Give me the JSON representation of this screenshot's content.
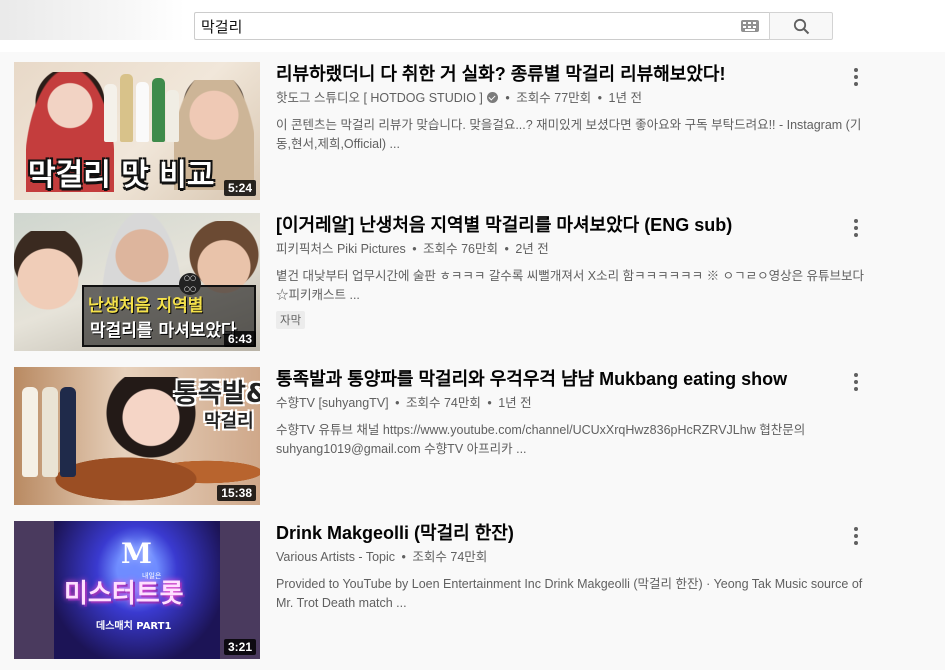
{
  "search": {
    "query": "막걸리",
    "keyboard_icon": "keyboard-icon",
    "button_icon": "search-icon"
  },
  "videos": [
    {
      "title": "리뷰하랬더니 다 취한 거 실화? 종류별 막걸리 리뷰해보았다!",
      "channel": "핫도그 스튜디오 [ HOTDOG STUDIO ]",
      "verified": true,
      "views": "조회수 77만회",
      "age": "1년 전",
      "description": "이 콘텐츠는 막걸리 리뷰가 맞습니다. 맞을걸요...? 재미있게 보셨다면 좋아요와 구독 부탁드려요!! - Instagram (기동,현서,제희,Official) ...",
      "duration": "5:24",
      "thumb_text": [
        "막걸리 맛 비교"
      ],
      "badge": ""
    },
    {
      "title": "[이거레알] 난생처음 지역별 막걸리를 마셔보았다 (ENG sub)",
      "channel": "피키픽처스 Piki Pictures",
      "verified": false,
      "views": "조회수 76만회",
      "age": "2년 전",
      "description": "볕건 대낮부터 업무시간에 술판 ㅎㅋㅋㅋ 갈수록 씨뻘개져서 X소리 함ㅋㅋㅋㅋㅋㅋ ※ ㅇㄱㄹㅇ영상은 유튜브보다 ☆피키캐스트 ...",
      "duration": "6:43",
      "thumb_text": [
        "난생처음 지역별",
        "막걸리를 마셔보았다"
      ],
      "badge": "자막"
    },
    {
      "title": "통족발과 통양파를 막걸리와 우걱우걱 냠냠 Mukbang eating show",
      "channel": "수향TV [suhyangTV]",
      "verified": false,
      "views": "조회수 74만회",
      "age": "1년 전",
      "description": "수향TV 유튜브 채널 https://www.youtube.com/channel/UCUxXrqHwz836pHcRZRVJLhw 협찬문의 suhyang1019@gmail.com 수향TV 아프리카 ...",
      "duration": "15:38",
      "thumb_text": [
        "통족발&",
        "막걸리"
      ],
      "badge": ""
    },
    {
      "title": "Drink Makgeolli (막걸리 한잔)",
      "channel": "Various Artists - Topic",
      "verified": false,
      "views": "조회수 74만회",
      "age": "",
      "description": "Provided to YouTube by Loen Entertainment Inc Drink Makgeolli (막걸리 한잔) · Yeong Tak Music source of Mr. Trot Death match ...",
      "duration": "3:21",
      "thumb_text": [
        "M",
        "미스터트롯",
        "내일은",
        "데스매치 PART1"
      ],
      "badge": ""
    }
  ],
  "colors": {
    "title": "#030303",
    "meta": "#606060",
    "background": "#f9f9f9"
  }
}
